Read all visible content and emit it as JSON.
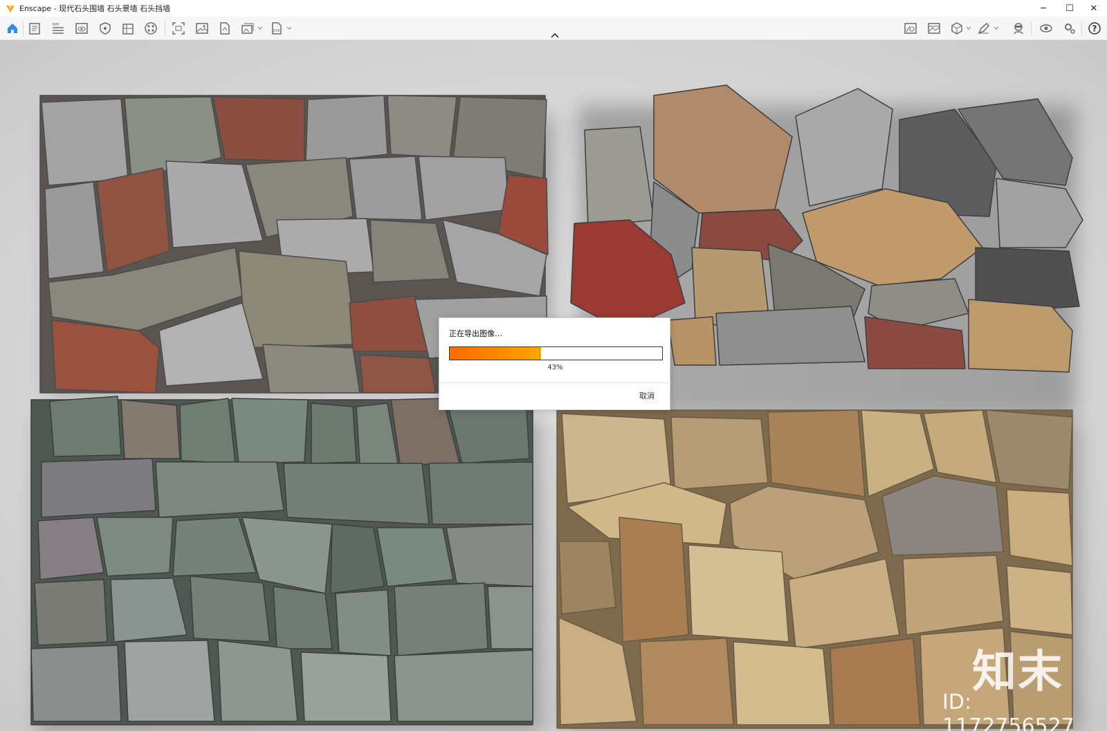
{
  "window": {
    "title": "Enscape - 现代石头围墙 石头景墙 石头挡墙",
    "minimize_glyph": "─",
    "maximize_glyph": "☐",
    "close_glyph": "✕"
  },
  "toolbar": {
    "left_icons": [
      "home-icon",
      "notes-icon",
      "bim-icon",
      "view-icon",
      "shield-icon",
      "building-icon",
      "material-palette-icon",
      "screenshot-icon",
      "image-icon",
      "pdf-export-icon",
      "batch-render-icon",
      "exe-export-icon"
    ],
    "bim_label": "BIM",
    "right_icons": [
      "asset-library-icon",
      "gallery-icon",
      "cube-view-icon",
      "pen-tool-icon",
      "vr-headset-icon",
      "visual-settings-icon",
      "settings-icon",
      "help-icon"
    ],
    "help_glyph": "?"
  },
  "colors": {
    "accent": "#f7a31c",
    "progress_start": "#ff6a00",
    "progress_end": "#ffa500",
    "icon_home": "#2a8ee8",
    "icon_gray": "#6b6b6b"
  },
  "viewport": {
    "watermark_logo": "知末",
    "watermark_id": "ID: 1172756527"
  },
  "export_dialog": {
    "message": "正在导出图像…",
    "progress_percent": 43,
    "progress_text": "43%",
    "cancel_label": "取消"
  }
}
